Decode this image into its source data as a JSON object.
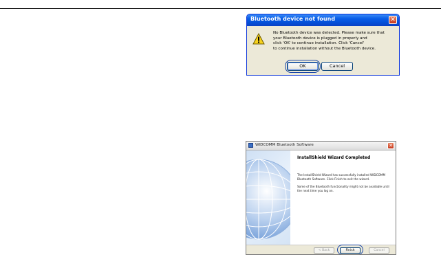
{
  "dialog_not_found": {
    "title": "Bluetooth device not found",
    "close_glyph": "✕",
    "icon": "warning-icon",
    "message_lines": [
      "No Bluetooth device was detected. Please make sure that",
      "your Bluetooth device is plugged in properly and",
      "click 'OK' to continue installation. Click 'Cancel'",
      "to continue installation without the Bluetooth device."
    ],
    "ok_label": "OK",
    "cancel_label": "Cancel"
  },
  "wizard": {
    "window_title": "WIDCOMM Bluetooth Software",
    "close_glyph": "✕",
    "heading": "InstallShield Wizard Completed",
    "paragraph1_lines": [
      "The InstallShield Wizard has successfully installed WIDCOMM",
      "Bluetooth Software. Click Finish to exit the wizard."
    ],
    "paragraph2_lines": [
      "Some of the Bluetooth functionality might not be available until",
      "the next time you log on."
    ],
    "back_label": "< Back",
    "finish_label": "Finish",
    "cancel_label": "Cancel"
  }
}
